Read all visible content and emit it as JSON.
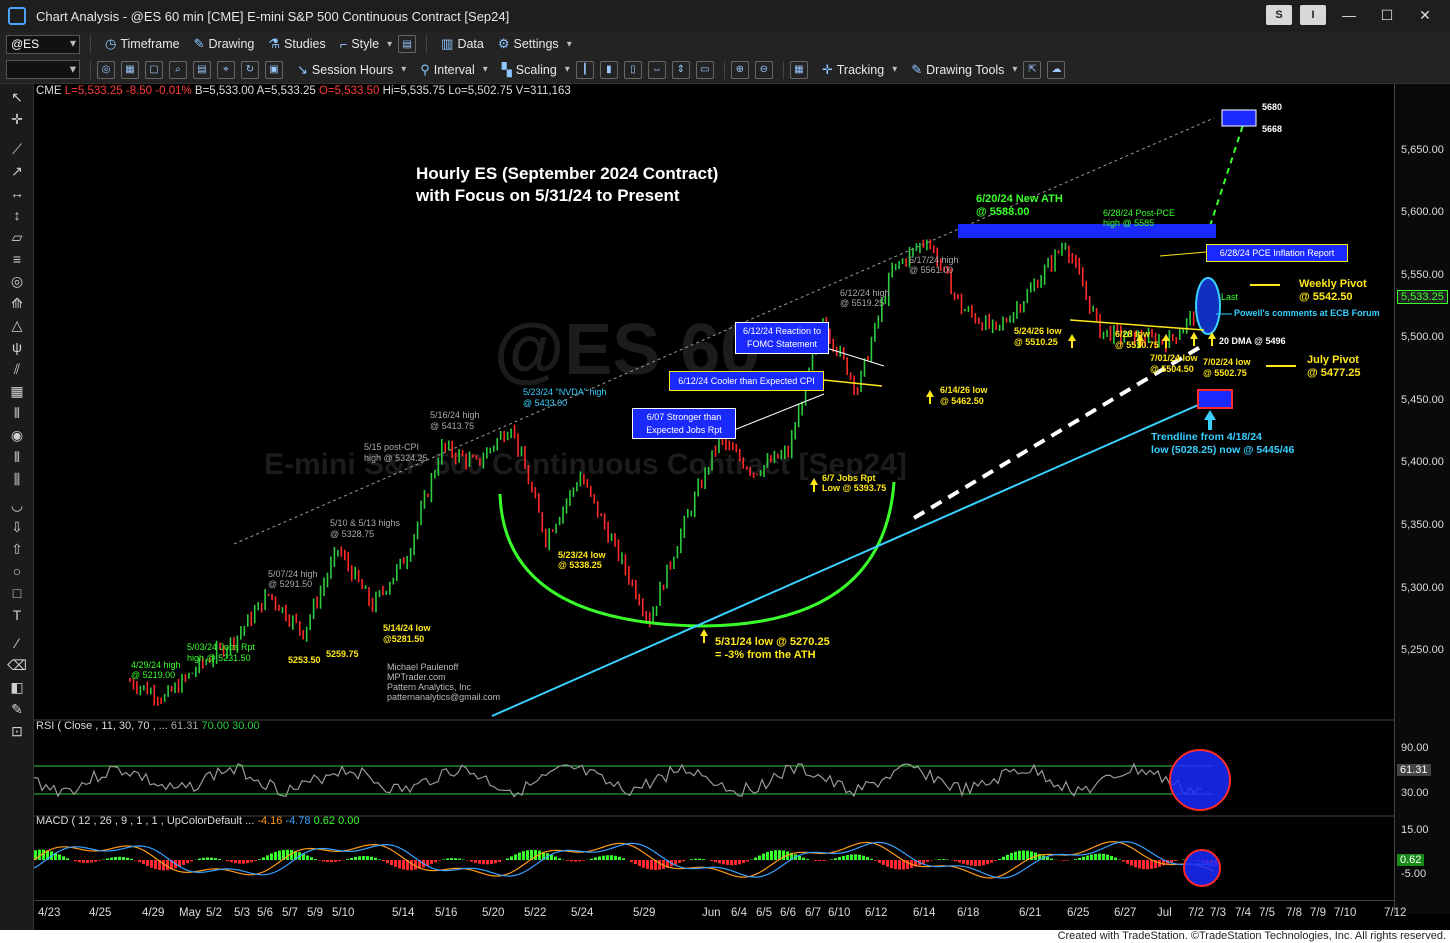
{
  "window": {
    "title": "Chart Analysis - @ES 60 min [CME] E-mini S&P 500 Continuous Contract [Sep24]",
    "btn_s": "S",
    "btn_i": "I"
  },
  "toolbar1": {
    "symbol": "@ES",
    "timeframe": "Timeframe",
    "drawing": "Drawing",
    "studies": "Studies",
    "style": "Style",
    "data": "Data",
    "settings": "Settings"
  },
  "toolbar2": {
    "session_hours": "Session Hours",
    "interval": "Interval",
    "scaling": "Scaling",
    "tracking": "Tracking",
    "drawing_tools": "Drawing Tools"
  },
  "info": {
    "exchange": "CME",
    "last": "L=5,533.25",
    "chg": "-8.50",
    "pct": "-0.01%",
    "bid": "B=5,533.00",
    "ask": "A=5,533.25",
    "open": "O=5,533.50",
    "high": "Hi=5,535.75",
    "low": "Lo=5,502.75",
    "vol": "V=311,163"
  },
  "price_axis": {
    "labels": [
      "5,650.00",
      "5,600.00",
      "5,550.00",
      "5,500.00",
      "5,450.00",
      "5,400.00",
      "5,350.00",
      "5,300.00",
      "5,250.00"
    ],
    "last_tag": "5,533.25",
    "rsi_labels": [
      "90.00",
      "61.31",
      "30.00"
    ],
    "macd_labels": [
      "15.00",
      "0.62",
      "-5.00"
    ]
  },
  "x_axis": {
    "labels": [
      "4/23",
      "4/25",
      "4/29",
      "May",
      "5/2",
      "5/3",
      "5/6",
      "5/7",
      "5/9",
      "5/10",
      "5/14",
      "5/16",
      "5/20",
      "5/22",
      "5/24",
      "5/29",
      "Jun",
      "6/4",
      "6/5",
      "6/6",
      "6/7",
      "6/10",
      "6/12",
      "6/14",
      "6/18",
      "6/21",
      "6/25",
      "6/27",
      "Jul",
      "7/2",
      "7/3",
      "7/4",
      "7/5",
      "7/8",
      "7/9",
      "7/10",
      "7/12"
    ]
  },
  "chart_data": {
    "type": "line",
    "title": "Hourly ES (September 2024 Contract)",
    "subtitle": "with Focus on 5/31/24 to Present",
    "ylim": [
      5200,
      5700
    ],
    "series": [
      {
        "name": "@ES 60 min",
        "points": [
          {
            "x": "4/29",
            "y": 5219.0
          },
          {
            "x": "5/2",
            "y": 5205.0
          },
          {
            "x": "5/3",
            "y": 5231.5
          },
          {
            "x": "5/6",
            "y": 5253.5
          },
          {
            "x": "5/7",
            "y": 5291.5
          },
          {
            "x": "5/9",
            "y": 5259.75
          },
          {
            "x": "5/10",
            "y": 5328.75
          },
          {
            "x": "5/14",
            "y": 5281.5
          },
          {
            "x": "5/15",
            "y": 5324.25
          },
          {
            "x": "5/16",
            "y": 5413.75
          },
          {
            "x": "5/20",
            "y": 5400.0
          },
          {
            "x": "5/23",
            "y": 5433.0
          },
          {
            "x": "5/23",
            "y": 5338.25
          },
          {
            "x": "5/24",
            "y": 5390.0
          },
          {
            "x": "5/29",
            "y": 5330.0
          },
          {
            "x": "5/31",
            "y": 5270.25
          },
          {
            "x": "6/4",
            "y": 5350.0
          },
          {
            "x": "6/6",
            "y": 5420.0
          },
          {
            "x": "6/7",
            "y": 5393.75
          },
          {
            "x": "6/11",
            "y": 5410.0
          },
          {
            "x": "6/12",
            "y": 5519.25
          },
          {
            "x": "6/14",
            "y": 5462.5
          },
          {
            "x": "6/17",
            "y": 5561.0
          },
          {
            "x": "6/20",
            "y": 5588.0
          },
          {
            "x": "6/21",
            "y": 5530.0
          },
          {
            "x": "6/24",
            "y": 5510.25
          },
          {
            "x": "6/27",
            "y": 5545.0
          },
          {
            "x": "6/28",
            "y": 5585.0
          },
          {
            "x": "6/28",
            "y": 5510.75
          },
          {
            "x": "7/01",
            "y": 5504.5
          },
          {
            "x": "7/02",
            "y": 5502.75
          },
          {
            "x": "7/02",
            "y": 5533.25
          }
        ]
      }
    ],
    "levels": {
      "weekly_pivot": 5542.5,
      "july_pivot": 5477.25,
      "dma_20": 5496,
      "target_high": 5680,
      "target_low": 5668,
      "trendline_now": "5445/46"
    }
  },
  "annotations": {
    "a_4_29": [
      "4/29/24 high",
      "@ 5219.00"
    ],
    "a_5_03": [
      "5/03/24 Jobs Rpt",
      "high @ 5231.50"
    ],
    "a_5253": "5253.50",
    "a_5259": "5259.75",
    "a_5_07": [
      "5/07/24 high",
      "@ 5291.50"
    ],
    "a_5_10": [
      "5/10 & 5/13 highs",
      "@ 5328.75"
    ],
    "a_5_14": [
      "5/14/24 low",
      "@5281.50"
    ],
    "a_5_15": [
      "5/15 post-CPI",
      "high @ 5324.25"
    ],
    "a_5_16": [
      "5/16/24 high",
      "@ 5413.75"
    ],
    "a_5_23h": [
      "5/23/24 \"NVDA\" high",
      "@ 5433.00"
    ],
    "a_5_23l": [
      "5/23/24 low",
      "@ 5338.25"
    ],
    "a_5_31": [
      "5/31/24 low @ 5270.25",
      "= -3% from the ATH"
    ],
    "a_6_07box": [
      "6/07 Stronger than",
      "Expected Jobs Rpt"
    ],
    "a_6_07": [
      "6/7 Jobs Rpt",
      "Low @ 5393.75"
    ],
    "a_6_12cpi": "6/12/24 Cooler than Expected CPI",
    "a_6_12fomc": [
      "6/12/24 Reaction to",
      "FOMC Statement"
    ],
    "a_6_12h": [
      "6/12/24 high",
      "@ 5519.25"
    ],
    "a_6_14": [
      "6/14/26 low",
      "@ 5462.50"
    ],
    "a_6_17": [
      "6/17/24 high",
      "@ 5561.00"
    ],
    "a_6_20": [
      "6/20/24 New ATH",
      "@ 5588.00"
    ],
    "a_6_28h": [
      "6/28/24 Post-PCE",
      "high @ 5585"
    ],
    "a_pce": "6/28/24 PCE Inflation Report",
    "a_5_24": [
      "5/24/26 low",
      "@ 5510.25"
    ],
    "a_6_28l": [
      "6/28 low",
      "@ 5510.75"
    ],
    "a_7_01": [
      "7/01/24 low",
      "@ 5504.50"
    ],
    "a_7_02": [
      "7/02/24 low",
      "@ 5502.75"
    ],
    "last": "Last",
    "powell": "Powell's comments at ECB Forum",
    "dma": "20 DMA @ 5496",
    "weekly": [
      "Weekly Pivot",
      "@ 5542.50"
    ],
    "july": [
      "July Pivot",
      "@ 5477.25"
    ],
    "trend": [
      "Trendline from 4/18/24",
      "low (5028.25) now @ 5445/46"
    ],
    "t5680": "5680",
    "t5668": "5668",
    "author": [
      "Michael Paulenoff",
      "MPTrader.com",
      "Pattern Analytics, Inc",
      "patternanalytics@gmail.com"
    ],
    "watermark1": "@ES 60",
    "watermark2": "E-mini S&P 500 Continuous Contract [Sep24]"
  },
  "rsi": {
    "label": "RSI ( Close , 11, 30, 70 , ...",
    "value": "61.31",
    "ob": "70.00",
    "os": "30.00"
  },
  "macd": {
    "label": "MACD ( 12 , 26 , 9 , 1 , 1 , UpColorDefault ...",
    "v1": "-4.16",
    "v2": "-4.78",
    "v3": "0.62",
    "v4": "0.00"
  },
  "status": {
    "credit": "Created with TradeStation. ©TradeStation Technologies, Inc. All rights reserved."
  },
  "colors": {
    "up": "#2ecc40",
    "down": "#ff2a2a",
    "yellow": "#ffe81a",
    "cyan": "#39d0ff",
    "green": "#39ff2a",
    "blue": "#1a2aff"
  }
}
